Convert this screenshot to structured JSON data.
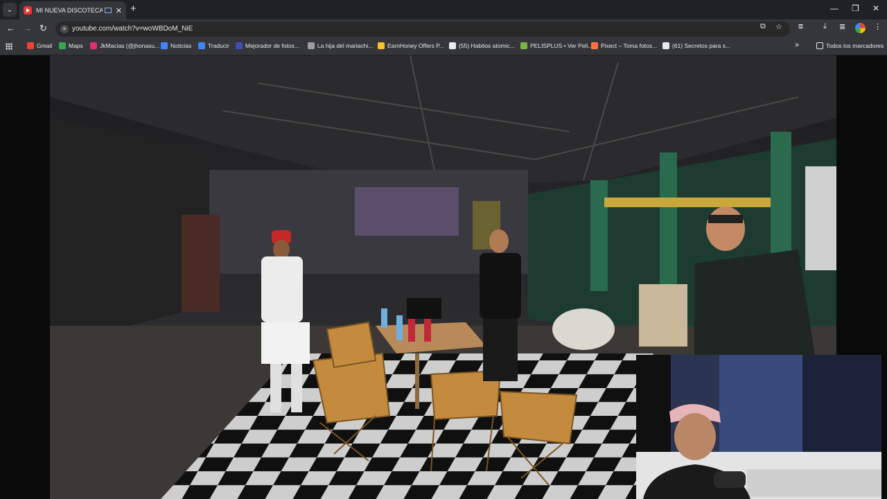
{
  "tab": {
    "title": "MI NUEVA DISCOTECA | W",
    "close": "✕"
  },
  "window": {
    "minimize": "—",
    "restore": "❐",
    "close": "✕"
  },
  "toolbar": {
    "back": "←",
    "forward": "→",
    "reload": "↻",
    "url": "youtube.com/watch?v=woWBDoM_NiE",
    "new_tab": "+"
  },
  "bookmarks": {
    "items": [
      {
        "label": "Gmail",
        "color": "#ea4335"
      },
      {
        "label": "Maps",
        "color": "#34a853"
      },
      {
        "label": "JkMacias (@jhonasu...",
        "color": "#e1306c"
      },
      {
        "label": "Noticias",
        "color": "#4285f4"
      },
      {
        "label": "Traducir",
        "color": "#4285f4"
      },
      {
        "label": "Mejorador de fotos...",
        "color": "#3f51b5"
      },
      {
        "label": "La hija del mariachi...",
        "color": "#9e9e9e"
      },
      {
        "label": "EarnHoney Offers P...",
        "color": "#fbc02d"
      },
      {
        "label": "(55) Habitos atomic...",
        "color": "#e8eaed"
      },
      {
        "label": "PELISPLUS • Ver Peli...",
        "color": "#7cb342"
      },
      {
        "label": "Pixect – Toma fotos...",
        "color": "#ff7043"
      },
      {
        "label": "(61) Secretos para s...",
        "color": "#e8eaed"
      }
    ],
    "overflow": "»",
    "all_bookmarks": "Todos los marcadores"
  },
  "colors": {
    "frame": "#202124",
    "toolbar": "#35363a",
    "accent": "#8ab4f8"
  }
}
